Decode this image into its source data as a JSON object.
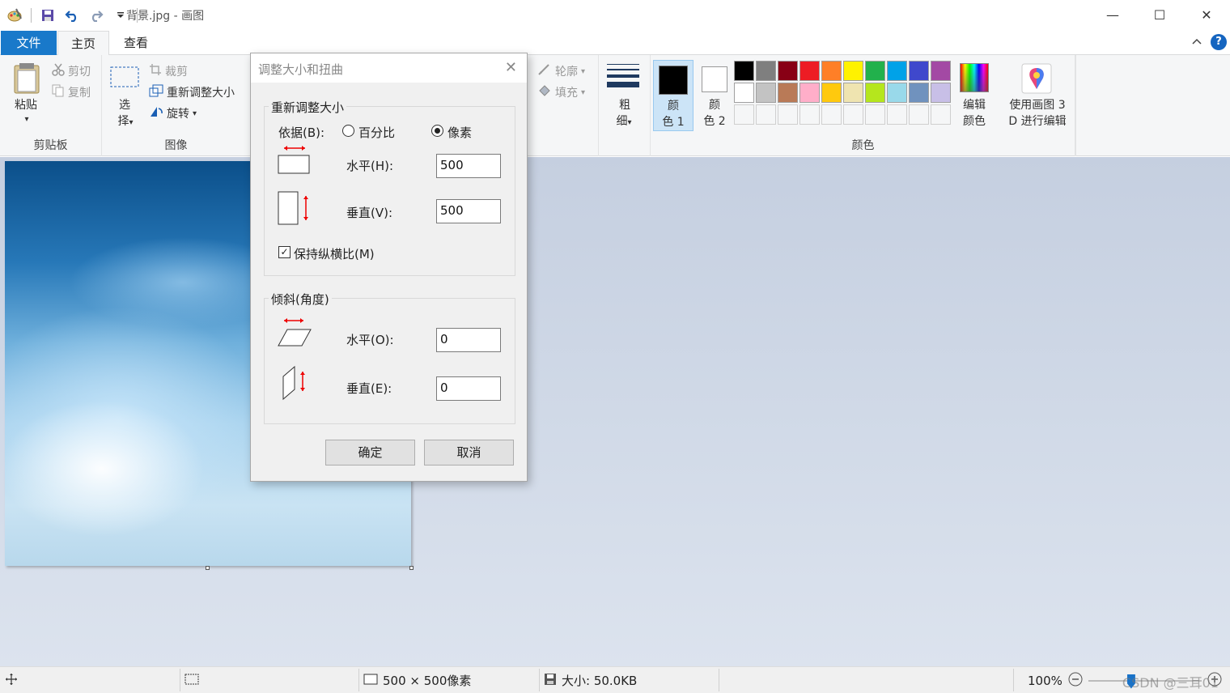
{
  "window": {
    "title": "背景.jpg - 画图",
    "controls": {
      "minimize": "—",
      "maximize": "☐",
      "close": "✕"
    }
  },
  "tabs": {
    "file": "文件",
    "home": "主页",
    "view": "查看",
    "help": "?"
  },
  "ribbon": {
    "clipboard": {
      "label": "剪贴板",
      "paste_1": "粘贴",
      "cut": "剪切",
      "copy": "复制"
    },
    "image": {
      "label": "图像",
      "select_1": "选",
      "select_2": "择",
      "crop": "裁剪",
      "resize": "重新调整大小",
      "rotate": "旋转"
    },
    "tools": {
      "outline": "轮廓",
      "fill": "填充"
    },
    "size": {
      "line1": "粗",
      "line2": "细"
    },
    "colors": {
      "label": "颜色",
      "color1_a": "颜",
      "color1_b": "色 1",
      "color2_a": "颜",
      "color2_b": "色 2",
      "edit_a": "编辑",
      "edit_b": "颜色",
      "palette": [
        "#000000",
        "#7f7f7f",
        "#880015",
        "#ed1c24",
        "#ff7f27",
        "#fff200",
        "#22b14c",
        "#00a2e8",
        "#3f48cc",
        "#a349a4",
        "#ffffff",
        "#c3c3c3",
        "#b97a57",
        "#ffaec9",
        "#ffc90e",
        "#efe4b0",
        "#b5e61d",
        "#99d9ea",
        "#7092be",
        "#c8bfe7"
      ],
      "color1": "#000000",
      "color2": "#ffffff"
    },
    "paint3d": {
      "line1": "使用画图 3",
      "line2": "D 进行编辑"
    }
  },
  "dialog": {
    "title": "调整大小和扭曲",
    "resize_section": "重新调整大小",
    "by_label": "依据(B):",
    "percent": "百分比",
    "pixels": "像素",
    "by_selected": "pixels",
    "horizontal_label": "水平(H):",
    "horizontal_value": "500",
    "vertical_label": "垂直(V):",
    "vertical_value": "500",
    "keep_ratio": "保持纵横比(M)",
    "keep_ratio_checked": true,
    "skew_section": "倾斜(角度)",
    "skew_h_label": "水平(O):",
    "skew_h_value": "0",
    "skew_v_label": "垂直(E):",
    "skew_v_value": "0",
    "ok": "确定",
    "cancel": "取消"
  },
  "status": {
    "dimensions": "500 × 500像素",
    "filesize": "大小: 50.0KB",
    "zoom": "100%",
    "watermark": "CSDN @三耳01"
  }
}
